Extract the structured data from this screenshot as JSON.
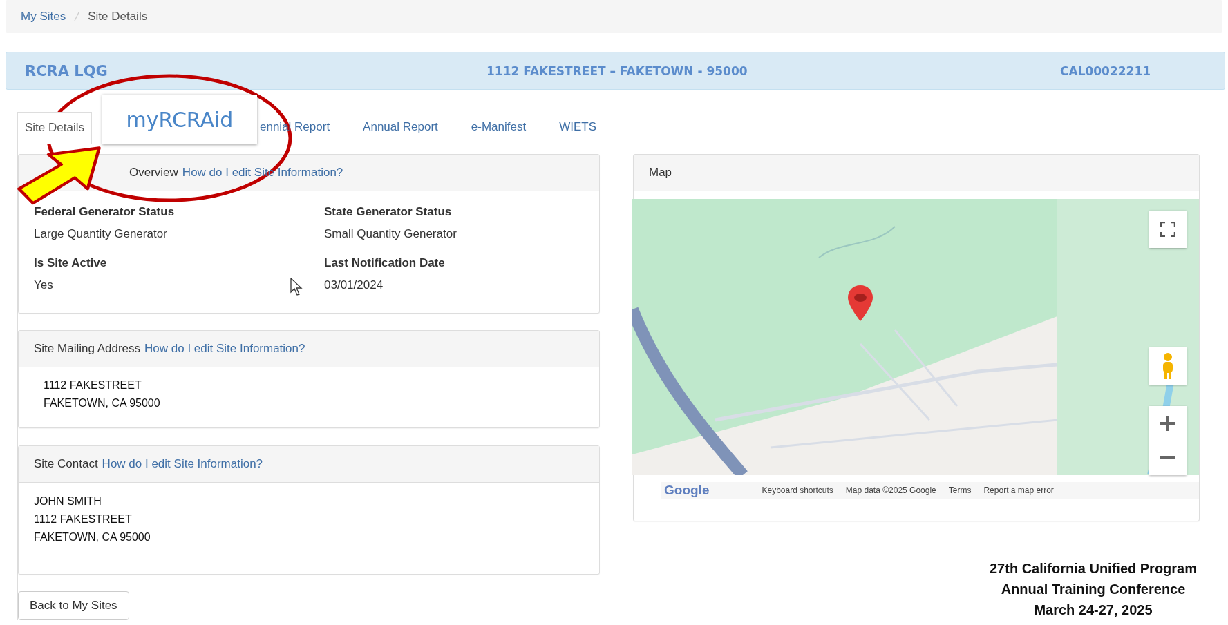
{
  "breadcrumb": [
    {
      "label": "My Sites",
      "kind": "link"
    },
    {
      "label": "Site Details",
      "kind": "current"
    }
  ],
  "header": {
    "site_type": "RCRA LQG",
    "address": "1112 FAKESTREET – FAKETOWN - 95000",
    "epa_id": "CAL00022211"
  },
  "tabs": [
    {
      "label": "Site Details",
      "selected": true
    },
    {
      "label": "ennial Report",
      "selected": false
    },
    {
      "label": "Annual Report",
      "selected": false
    },
    {
      "label": "e-Manifest",
      "selected": false
    },
    {
      "label": "WIETS",
      "selected": false
    }
  ],
  "callout": {
    "label": "myRCRAid"
  },
  "overview": {
    "title": "Overview",
    "link": "How do I edit Site Information?",
    "fields": [
      {
        "label": "Federal Generator Status",
        "value": "Large Quantity Generator"
      },
      {
        "label": "State Generator Status",
        "value": "Small Quantity Generator"
      },
      {
        "label": "Is Site Active",
        "value": "Yes"
      },
      {
        "label": "Last Notification Date",
        "value": "03/01/2024"
      }
    ]
  },
  "mailing": {
    "title": "Site Mailing Address",
    "link": "How do I edit Site Information?",
    "lines": [
      "1112 FAKESTREET",
      "FAKETOWN, CA 95000"
    ]
  },
  "contact": {
    "title": "Site Contact",
    "link": "How do I edit Site Information?",
    "lines": [
      "JOHN SMITH",
      "1112 FAKESTREET",
      "FAKETOWN, CA 95000"
    ]
  },
  "back_button": "Back to My Sites",
  "map": {
    "title": "Map",
    "logo": "Google",
    "attribution": [
      "Keyboard shortcuts",
      "Map data ©2025 Google",
      "Terms",
      "Report a map error"
    ]
  },
  "conference": [
    "27th California Unified Program",
    "Annual Training Conference",
    "March 24-27, 2025"
  ]
}
